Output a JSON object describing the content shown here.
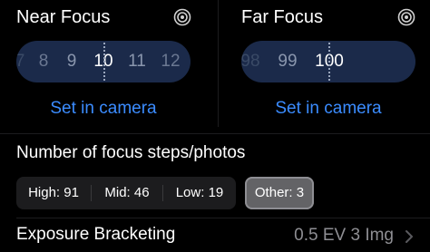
{
  "near_focus": {
    "label": "Near Focus",
    "icon": "target-icon",
    "ticks": [
      "7",
      "8",
      "9",
      "10",
      "11",
      "12"
    ],
    "selected": "10",
    "action_label": "Set in camera"
  },
  "far_focus": {
    "label": "Far Focus",
    "icon": "target-icon",
    "ticks": [
      "98",
      "99",
      "100"
    ],
    "selected": "100",
    "action_label": "Set in camera"
  },
  "steps": {
    "label": "Number of focus steps/photos",
    "options": [
      {
        "label": "High: 91",
        "selected": false
      },
      {
        "label": "Mid: 46",
        "selected": false
      },
      {
        "label": "Low: 19",
        "selected": false
      },
      {
        "label": "Other: 3",
        "selected": true
      }
    ]
  },
  "exposure": {
    "label": "Exposure Bracketing",
    "value": "0.5 EV 3 Img",
    "chevron_icon": "chevron-right-icon"
  },
  "colors": {
    "background": "#000000",
    "picker": "#1b2a4a",
    "accent": "#3b8cff",
    "secondary_text": "#8e8e93"
  }
}
